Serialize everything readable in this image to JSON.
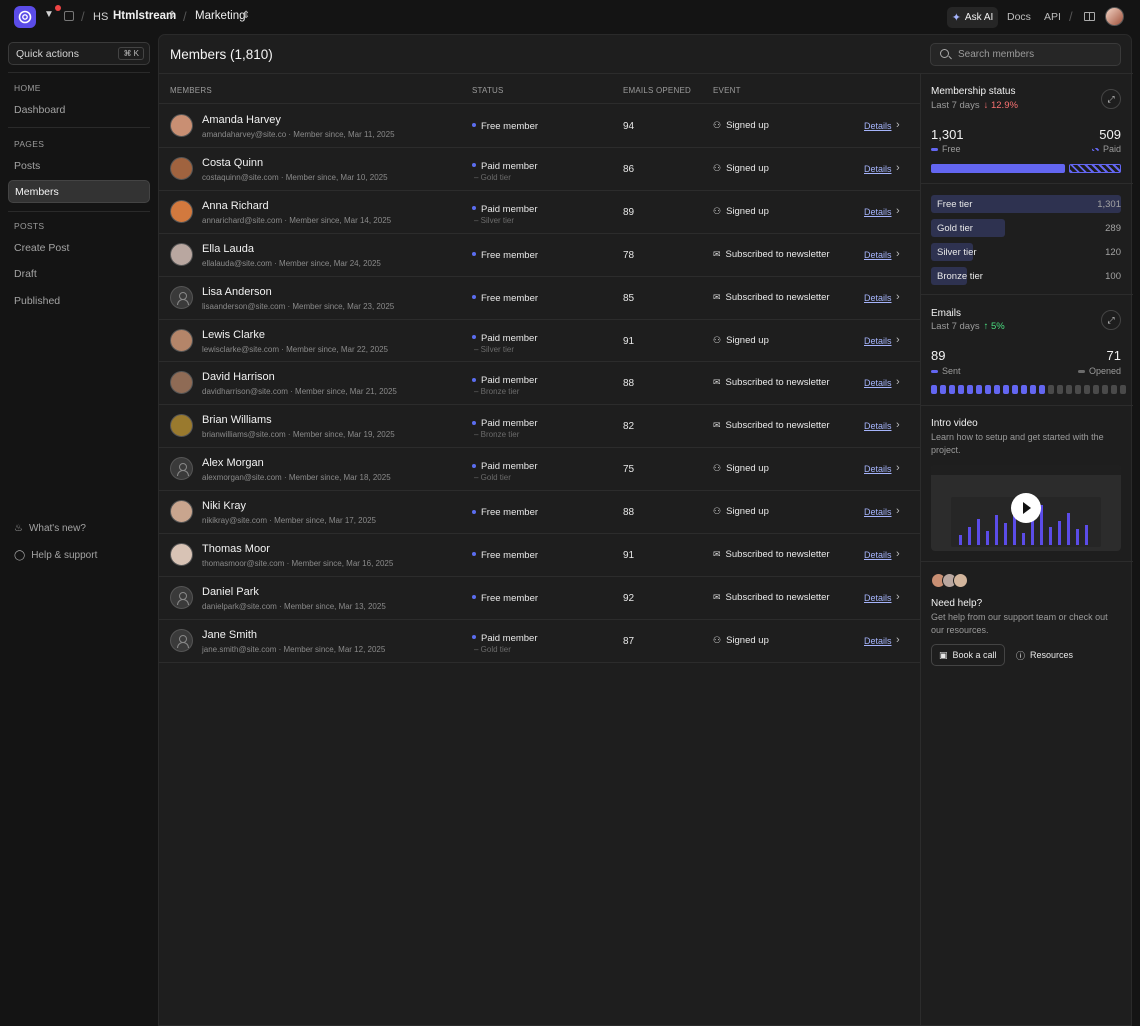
{
  "topbar": {
    "workspace_initials": "HS",
    "workspace_name": "Htmlstream",
    "project": "Marketing",
    "ask_ai": "Ask AI",
    "docs": "Docs",
    "api": "API"
  },
  "sidebar": {
    "quick_actions": "Quick actions",
    "quick_actions_kbd": "⌘ K",
    "home_header": "HOME",
    "dashboard": "Dashboard",
    "pages_header": "PAGES",
    "posts": "Posts",
    "members": "Members",
    "posts_header": "POSTS",
    "create_post": "Create Post",
    "draft": "Draft",
    "published": "Published",
    "whats_new": "What's new?",
    "help_support": "Help & support"
  },
  "main": {
    "title": "Members (1,810)",
    "search_placeholder": "Search members",
    "columns": {
      "members": "MEMBERS",
      "status": "STATUS",
      "emails_opened": "EMAILS OPENED",
      "event": "EVENT"
    },
    "details_label": "Details",
    "members": [
      {
        "name": "Amanda Harvey",
        "email": "amandaharvey@site.co",
        "since": "Member since, Mar 11, 2025",
        "status": "Free member",
        "tier": "",
        "emails": "94",
        "event": "Signed up",
        "event_icon": "user-plus-icon",
        "avatar_color": "#c98f73"
      },
      {
        "name": "Costa Quinn",
        "email": "costaquinn@site.com",
        "since": "Member since, Mar 10, 2025",
        "status": "Paid member",
        "tier": "– Gold tier",
        "emails": "86",
        "event": "Signed up",
        "event_icon": "user-plus-icon",
        "avatar_color": "#a0633f"
      },
      {
        "name": "Anna Richard",
        "email": "annarichard@site.com",
        "since": "Member since, Mar 14, 2025",
        "status": "Paid member",
        "tier": "– Silver tier",
        "emails": "89",
        "event": "Signed up",
        "event_icon": "user-plus-icon",
        "avatar_color": "#d2793e"
      },
      {
        "name": "Ella Lauda",
        "email": "ellalauda@site.com",
        "since": "Member since, Mar 24, 2025",
        "status": "Free member",
        "tier": "",
        "emails": "78",
        "event": "Subscribed to newsletter",
        "event_icon": "mail-icon",
        "avatar_color": "#b9a7a0"
      },
      {
        "name": "Lisa Anderson",
        "email": "lisaanderson@site.com",
        "since": "Member since, Mar 23, 2025",
        "status": "Free member",
        "tier": "",
        "emails": "85",
        "event": "Subscribed to newsletter",
        "event_icon": "mail-icon",
        "avatar_color": ""
      },
      {
        "name": "Lewis Clarke",
        "email": "lewisclarke@site.com",
        "since": "Member since, Mar 22, 2025",
        "status": "Paid member",
        "tier": "– Silver tier",
        "emails": "91",
        "event": "Signed up",
        "event_icon": "user-plus-icon",
        "avatar_color": "#b48569"
      },
      {
        "name": "David Harrison",
        "email": "davidharrison@site.com",
        "since": "Member since, Mar 21, 2025",
        "status": "Paid member",
        "tier": "– Bronze tier",
        "emails": "88",
        "event": "Subscribed to newsletter",
        "event_icon": "mail-icon",
        "avatar_color": "#8f6b55"
      },
      {
        "name": "Brian Williams",
        "email": "brianwilliams@site.com",
        "since": "Member since, Mar 19, 2025",
        "status": "Paid member",
        "tier": "– Bronze tier",
        "emails": "82",
        "event": "Subscribed to newsletter",
        "event_icon": "mail-icon",
        "avatar_color": "#9a7a2e"
      },
      {
        "name": "Alex Morgan",
        "email": "alexmorgan@site.com",
        "since": "Member since, Mar 18, 2025",
        "status": "Paid member",
        "tier": "– Gold tier",
        "emails": "75",
        "event": "Signed up",
        "event_icon": "user-plus-icon",
        "avatar_color": ""
      },
      {
        "name": "Niki Kray",
        "email": "nikikray@site.com",
        "since": "Member since, Mar 17, 2025",
        "status": "Free member",
        "tier": "",
        "emails": "88",
        "event": "Signed up",
        "event_icon": "user-plus-icon",
        "avatar_color": "#c9a58e"
      },
      {
        "name": "Thomas Moor",
        "email": "thomasmoor@site.com",
        "since": "Member since, Mar 16, 2025",
        "status": "Free member",
        "tier": "",
        "emails": "91",
        "event": "Subscribed to newsletter",
        "event_icon": "mail-icon",
        "avatar_color": "#d8c3b5"
      },
      {
        "name": "Daniel Park",
        "email": "danielpark@site.com",
        "since": "Member since, Mar 13, 2025",
        "status": "Free member",
        "tier": "",
        "emails": "92",
        "event": "Subscribed to newsletter",
        "event_icon": "mail-icon",
        "avatar_color": ""
      },
      {
        "name": "Jane Smith",
        "email": "jane.smith@site.com",
        "since": "Member since, Mar 12, 2025",
        "status": "Paid member",
        "tier": "– Gold tier",
        "emails": "87",
        "event": "Signed up",
        "event_icon": "user-plus-icon",
        "avatar_color": ""
      }
    ]
  },
  "membership": {
    "title": "Membership status",
    "period": "Last 7 days",
    "change": "↓ 12.9%",
    "free_count": "1,301",
    "free_label": "Free",
    "paid_count": "509",
    "paid_label": "Paid",
    "free_share": 0.72,
    "tiers": [
      {
        "label": "Free tier",
        "value": "1,301",
        "share": 1.0
      },
      {
        "label": "Gold tier",
        "value": "289",
        "share": 0.39
      },
      {
        "label": "Silver tier",
        "value": "120",
        "share": 0.22
      },
      {
        "label": "Bronze tier",
        "value": "100",
        "share": 0.19
      }
    ]
  },
  "emails": {
    "title": "Emails",
    "period": "Last 7 days",
    "change": "↑ 5%",
    "sent": "89",
    "sent_label": "Sent",
    "opened": "71",
    "opened_label": "Opened",
    "filled_blocks": 13,
    "total_blocks": 22
  },
  "intro": {
    "title": "Intro video",
    "desc": "Learn how to setup and get started with the project."
  },
  "help": {
    "title": "Need help?",
    "desc": "Get help from our support team or check out our resources.",
    "book_call": "Book a call",
    "resources": "Resources"
  },
  "colors": {
    "accent": "#5b4ce8",
    "bar": "#6366f1",
    "negative": "#f87171",
    "positive": "#4ade80"
  }
}
